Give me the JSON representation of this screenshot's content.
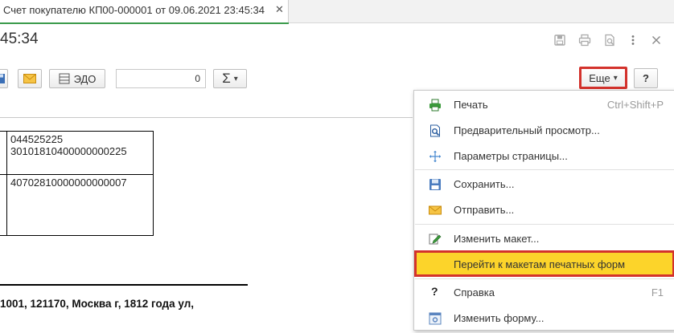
{
  "tab": {
    "title": "Счет покупателю КП00-000001 от 09.06.2021 23:45:34",
    "close": "✕"
  },
  "header": {
    "title": "45:34"
  },
  "toolbar": {
    "edo_label": "ЭДО",
    "counter_value": "0",
    "sigma": "Σ",
    "more_label": "Еще",
    "help_label": "?",
    "arrow": "▾"
  },
  "document": {
    "bik": "044525225",
    "corr_account": "30101810400000000225",
    "account": "40702810000000000007",
    "address": "1001, 121170, Москва г, 1812 года ул,"
  },
  "menu": {
    "items": [
      {
        "label": "Печать",
        "shortcut": "Ctrl+Shift+P"
      },
      {
        "label": "Предварительный просмотр...",
        "shortcut": ""
      },
      {
        "label": "Параметры страницы...",
        "shortcut": ""
      },
      {
        "label": "Сохранить...",
        "shortcut": ""
      },
      {
        "label": "Отправить...",
        "shortcut": ""
      },
      {
        "label": "Изменить макет...",
        "shortcut": ""
      },
      {
        "label": "Перейти к макетам печатных форм",
        "shortcut": ""
      },
      {
        "label": "Справка",
        "shortcut": "F1"
      },
      {
        "label": "Изменить форму...",
        "shortcut": ""
      }
    ]
  },
  "colors": {
    "highlight": "#fcd42a",
    "outline_red": "#d3322c",
    "tab_green": "#3a9a4a"
  }
}
